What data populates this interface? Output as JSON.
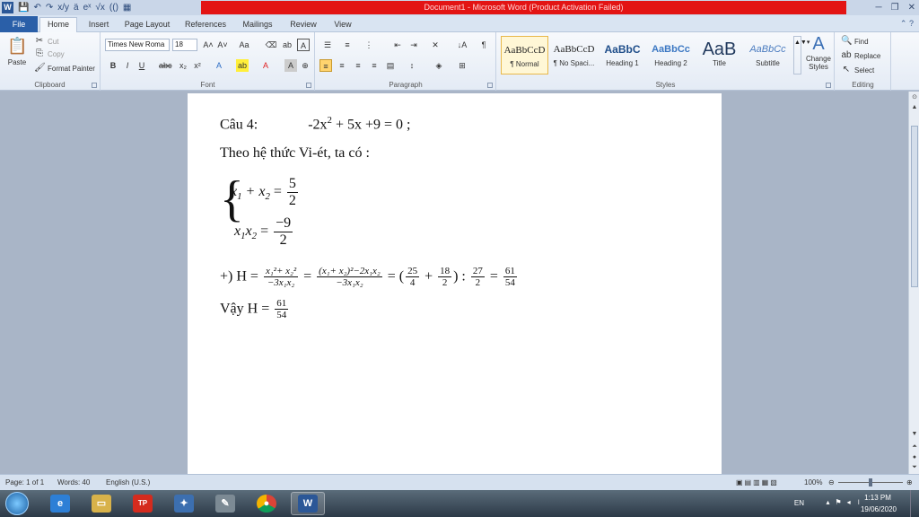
{
  "app": {
    "title": "Document1 - Microsoft Word (Product Activation Failed)"
  },
  "tabs": [
    "File",
    "Home",
    "Insert",
    "Page Layout",
    "References",
    "Mailings",
    "Review",
    "View"
  ],
  "clipboard": {
    "paste": "Paste",
    "cut": "Cut",
    "copy": "Copy",
    "format_painter": "Format Painter",
    "label": "Clipboard"
  },
  "font": {
    "name": "Times New Roma",
    "size": "18",
    "label": "Font"
  },
  "paragraph": {
    "label": "Paragraph"
  },
  "styles": {
    "items": [
      {
        "preview": "AaBbCcD",
        "name": "¶ Normal"
      },
      {
        "preview": "AaBbCcD",
        "name": "¶ No Spaci..."
      },
      {
        "preview": "AaBbC",
        "name": "Heading 1"
      },
      {
        "preview": "AaBbCc",
        "name": "Heading 2"
      },
      {
        "preview": "AaB",
        "name": "Title"
      },
      {
        "preview": "AaBbCc",
        "name": "Subtitle"
      }
    ],
    "change": "Change Styles",
    "label": "Styles"
  },
  "editing": {
    "find": "Find",
    "replace": "Replace",
    "select": "Select",
    "label": "Editing"
  },
  "doc": {
    "l1_label": "Câu 4:",
    "l1_eq_a": "-2x",
    "l1_sup": "2",
    "l1_eq_b": " + 5x +9 = 0 ;",
    "l2": "Theo hệ thức Vi-ét, ta có :",
    "sys_r1_lhs": "x",
    "sys_r1_mid": " + x",
    "sys_r1_sub": "1",
    "sys_r1_sub2": "2",
    "sys_r1_eq": " = ",
    "sys_r1_num": "5",
    "sys_r1_den": "2",
    "sys_r2_a": "x",
    "sys_r2_sub1": "1",
    "sys_r2_b": "x",
    "sys_r2_sub2": "2",
    "sys_r2_eq": " = ",
    "sys_r2_num": "−9",
    "sys_r2_den": "2",
    "h_prefix": "+) H =",
    "h_f1_num": "x₁²+ x₂²",
    "h_f1_den": "−3x₁x₂",
    "h_f2_num": "(x₁+ x₂)²−2x₁x₂",
    "h_f2_den": "−3x₁x₂",
    "h_open": "= (",
    "h_f3_num": "25",
    "h_f3_den": "4",
    "h_plus": "+",
    "h_f4_num": "18",
    "h_f4_den": "2",
    "h_close": ") :",
    "h_f5_num": "27",
    "h_f5_den": "2",
    "h_eq": "=",
    "h_f6_num": "61",
    "h_f6_den": "54",
    "vay_prefix": "Vậy H =",
    "vay_num": "61",
    "vay_den": "54"
  },
  "status": {
    "page": "Page: 1 of 1",
    "words": "Words: 40",
    "lang": "English (U.S.)",
    "zoom": "100%"
  },
  "tray": {
    "lang": "EN",
    "time": "1:13 PM",
    "date": "19/06/2020"
  }
}
